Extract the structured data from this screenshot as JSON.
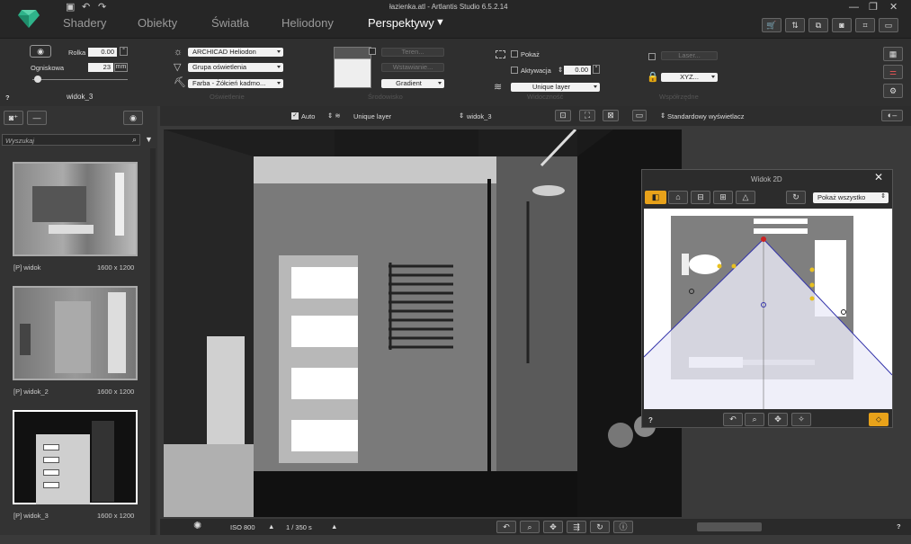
{
  "window": {
    "title": "łazienka.atl - Artlantis Studio 6.5.2.14"
  },
  "tabs": [
    {
      "label": "Shadery"
    },
    {
      "label": "Obiekty"
    },
    {
      "label": "Światła"
    },
    {
      "label": "Heliodony"
    },
    {
      "label": "Perspektywy"
    }
  ],
  "camera": {
    "roll_label": "Rolka",
    "roll_value": "0.00",
    "roll_unit": "°",
    "focal_label": "Ogniskowa",
    "focal_value": "23",
    "focal_unit": "mm",
    "view_name": "widok_3",
    "help": "?"
  },
  "lighting": {
    "heliodon": "ARCHICAD Heliodon",
    "light_group": "Grupa oświetlenia",
    "paint": "Farba - Żółcień kadmo...",
    "group_label": "Oświetlenie"
  },
  "environment": {
    "teren": "Teren...",
    "wstawianie": "Wstawianie...",
    "background": "Gradient",
    "group_label": "Środowisko"
  },
  "visibility": {
    "show_label": "Pokaż",
    "activation_label": "Aktywacja",
    "activation_value": "0.00",
    "layer": "Unique layer",
    "group_label": "Widoczność"
  },
  "coords": {
    "laser": "Laser...",
    "xyz": "XYZ...",
    "group_label": "Współrzędne"
  },
  "viewbar": {
    "auto_label": "Auto",
    "layer": "Unique layer",
    "view": "widok_3",
    "display": "Standardowy wyświetlacz"
  },
  "left": {
    "search_placeholder": "Wyszukaj",
    "views": [
      {
        "name": "[P] widok",
        "size": "1600 x 1200"
      },
      {
        "name": "[P] widok_2",
        "size": "1600 x 1200"
      },
      {
        "name": "[P] widok_3",
        "size": "1600 x 1200"
      }
    ]
  },
  "bottom": {
    "iso": "ISO  800",
    "shutter": "1 / 350 s",
    "help": "?"
  },
  "widok2d": {
    "title": "Widok 2D",
    "show_all": "Pokaż wszystko",
    "help": "?"
  }
}
